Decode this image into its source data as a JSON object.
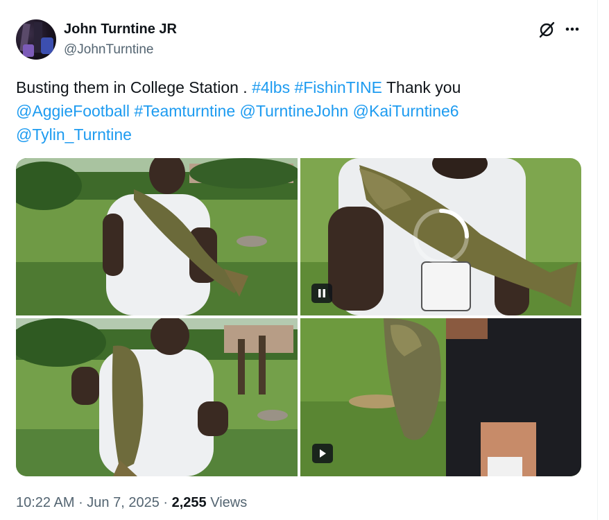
{
  "author": {
    "display_name": "John Turntine JR",
    "handle": "@JohnTurntine",
    "avatar": "profile-photo"
  },
  "header_icons": [
    "grok-icon",
    "more-options-icon"
  ],
  "tweet": {
    "segments": [
      {
        "text": "Busting them in College Station . ",
        "type": "text"
      },
      {
        "text": "#4lbs",
        "type": "hashtag"
      },
      {
        "text": " ",
        "type": "text"
      },
      {
        "text": "#FishinTINE",
        "type": "hashtag"
      },
      {
        "text": "  Thank you ",
        "type": "text"
      },
      {
        "text": "@AggieFootball",
        "type": "mention"
      },
      {
        "text": "  ",
        "type": "text"
      },
      {
        "text": "#Teamturntine",
        "type": "hashtag"
      },
      {
        "text": " ",
        "type": "text"
      },
      {
        "text": "@TurntineJohn",
        "type": "mention"
      },
      {
        "text": " ",
        "type": "text"
      },
      {
        "text": "@KaiTurntine6",
        "type": "mention"
      },
      {
        "text": " ",
        "type": "text"
      },
      {
        "text": "@Tylin_Turntine",
        "type": "mention"
      }
    ]
  },
  "media": {
    "tiles": [
      {
        "kind": "photo"
      },
      {
        "kind": "video",
        "control": "pause-icon",
        "loading": true
      },
      {
        "kind": "photo"
      },
      {
        "kind": "video",
        "control": "play-icon"
      }
    ]
  },
  "meta": {
    "time": "10:22 AM",
    "sep1": " · ",
    "date": "Jun 7, 2025",
    "sep2": " · ",
    "views_count": "2,255",
    "views_label": " Views"
  },
  "colors": {
    "link": "#1d9bf0",
    "text": "#0f1419",
    "secondary": "#536471"
  }
}
